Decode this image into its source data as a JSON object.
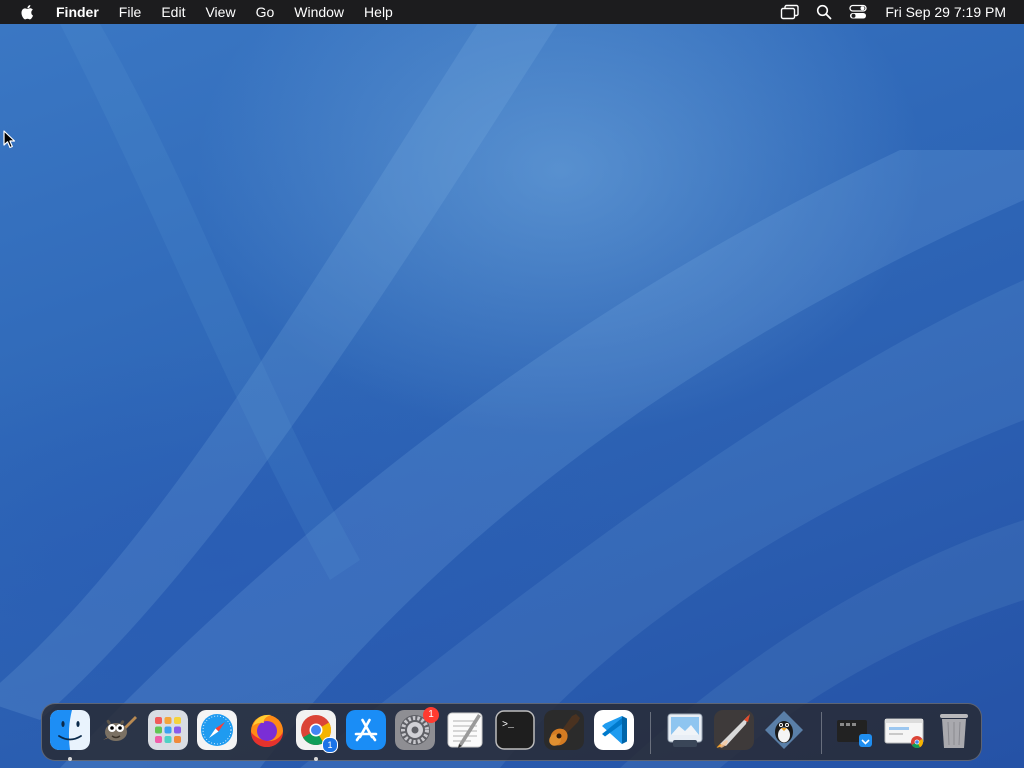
{
  "menubar": {
    "app_name": "Finder",
    "items": [
      "File",
      "Edit",
      "View",
      "Go",
      "Window",
      "Help"
    ],
    "clock": "Fri Sep 29  7:19 PM",
    "status_icons": [
      "screen-mirroring-icon",
      "spotlight-search-icon",
      "control-center-icon"
    ]
  },
  "dock": {
    "apps": [
      {
        "name": "Finder",
        "icon": "finder-icon",
        "running": true
      },
      {
        "name": "GIMP",
        "icon": "gimp-icon",
        "running": false
      },
      {
        "name": "Launchpad",
        "icon": "launchpad-icon",
        "running": false
      },
      {
        "name": "Safari",
        "icon": "safari-icon",
        "running": false
      },
      {
        "name": "Firefox",
        "icon": "firefox-icon",
        "running": false
      },
      {
        "name": "Google Chrome",
        "icon": "chrome-icon",
        "running": true,
        "badge": "1"
      },
      {
        "name": "App Store",
        "icon": "app-store-icon",
        "running": false
      },
      {
        "name": "System Settings",
        "icon": "system-settings-icon",
        "running": false,
        "badge": "1"
      },
      {
        "name": "TextEdit",
        "icon": "textedit-icon",
        "running": false
      },
      {
        "name": "Terminal",
        "icon": "terminal-icon",
        "running": false,
        "glyph": ">_"
      },
      {
        "name": "GarageBand",
        "icon": "guitar-icon",
        "running": false
      },
      {
        "name": "Visual Studio Code",
        "icon": "vscode-icon",
        "running": false
      }
    ],
    "recent": [
      {
        "name": "Preview",
        "icon": "preview-icon"
      },
      {
        "name": "Rocket",
        "icon": "rocket-icon"
      },
      {
        "name": "Tux Game",
        "icon": "tux-icon"
      }
    ],
    "stacks": [
      {
        "name": "Desktop Folder",
        "icon": "folder-stack-icon"
      },
      {
        "name": "Downloads",
        "icon": "downloads-stack-icon"
      },
      {
        "name": "Trash",
        "icon": "trash-icon"
      }
    ]
  },
  "colors": {
    "menubar_bg": "#1c1c1e",
    "wallpaper_base": "#2d63b4",
    "badge_red": "#ff3b30"
  }
}
